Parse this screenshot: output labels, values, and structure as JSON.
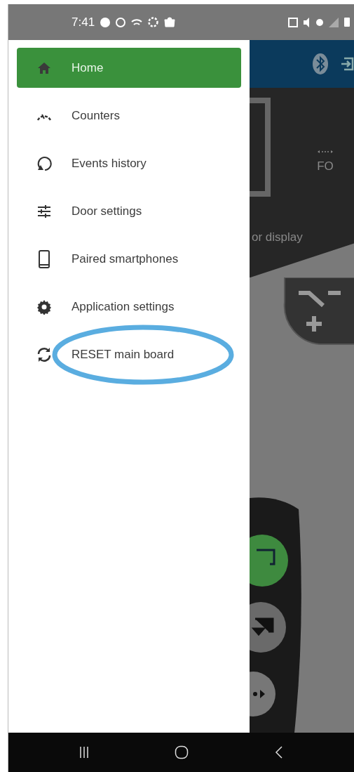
{
  "status_bar": {
    "time": "7:41"
  },
  "drawer": {
    "items": [
      {
        "label": "Home",
        "selected": true,
        "circled": false
      },
      {
        "label": "Counters",
        "selected": false,
        "circled": false
      },
      {
        "label": "Events history",
        "selected": false,
        "circled": false
      },
      {
        "label": "Door settings",
        "selected": false,
        "circled": false
      },
      {
        "label": "Paired smartphones",
        "selected": false,
        "circled": false
      },
      {
        "label": "Application settings",
        "selected": false,
        "circled": false
      },
      {
        "label": "RESET main board",
        "selected": false,
        "circled": true
      }
    ]
  },
  "background_app": {
    "display_value": "FO",
    "caption": "or display"
  }
}
